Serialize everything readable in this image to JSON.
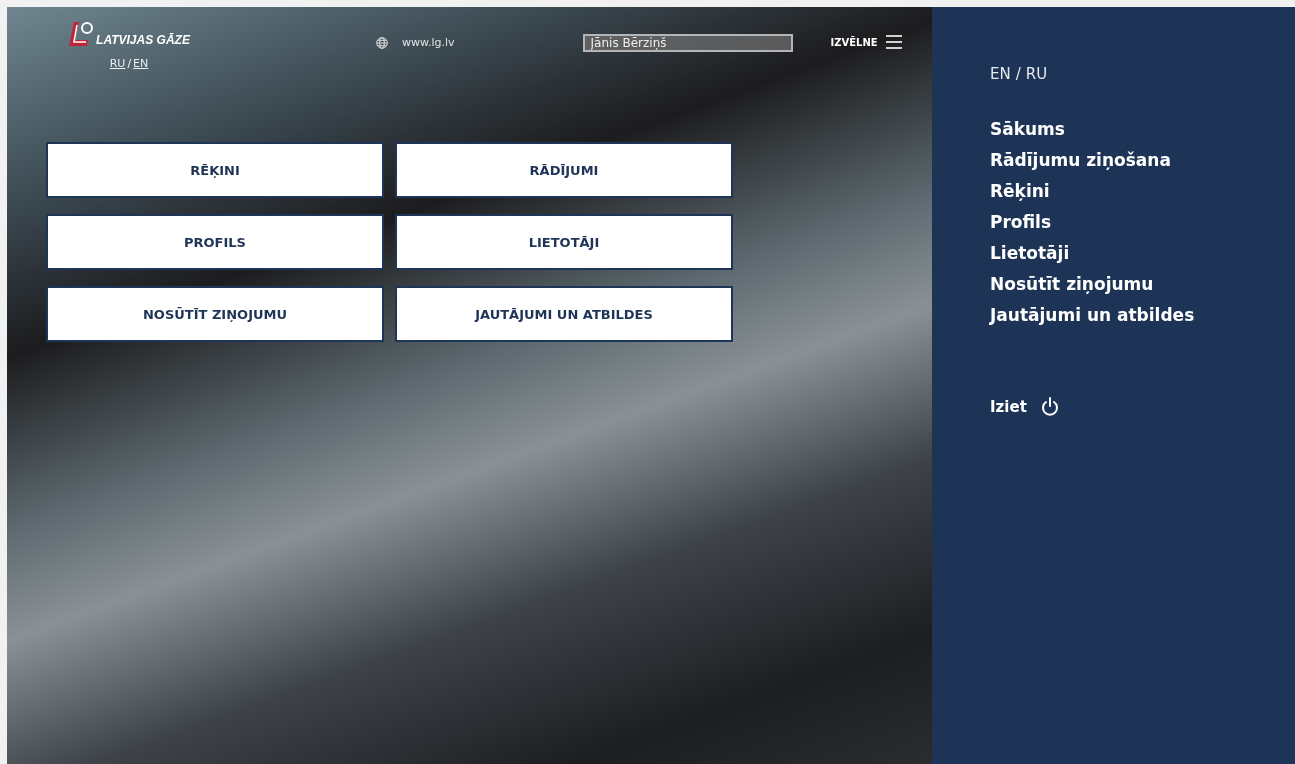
{
  "header": {
    "logo_text": "LATVIJAS GĀZE",
    "languages": [
      {
        "label": "RU"
      },
      {
        "label": "EN"
      }
    ],
    "language_separator": "/",
    "website": "www.lg.lv",
    "user_field": {
      "value": "Jānis Bērziņš"
    },
    "menu_label": "IZVĒLNE"
  },
  "tiles": [
    {
      "label": "RĒĶINI"
    },
    {
      "label": "RĀDĪJUMI"
    },
    {
      "label": "PROFILS"
    },
    {
      "label": "LIETOTĀJI"
    },
    {
      "label": "NOSŪTĪT ZIŅOJUMU"
    },
    {
      "label": "JAUTĀJUMI UN ATBILDES"
    }
  ],
  "sidebar": {
    "languages": [
      {
        "label": "EN"
      },
      {
        "label": "RU"
      }
    ],
    "language_separator": "/",
    "items": [
      {
        "label": "Sākums"
      },
      {
        "label": "Rādījumu ziņošana"
      },
      {
        "label": "Rēķini"
      },
      {
        "label": "Profils"
      },
      {
        "label": "Lietotāji"
      },
      {
        "label": "Nosūtīt ziņojumu"
      },
      {
        "label": "Jautājumi un atbildes"
      }
    ],
    "logout": "Iziet"
  }
}
